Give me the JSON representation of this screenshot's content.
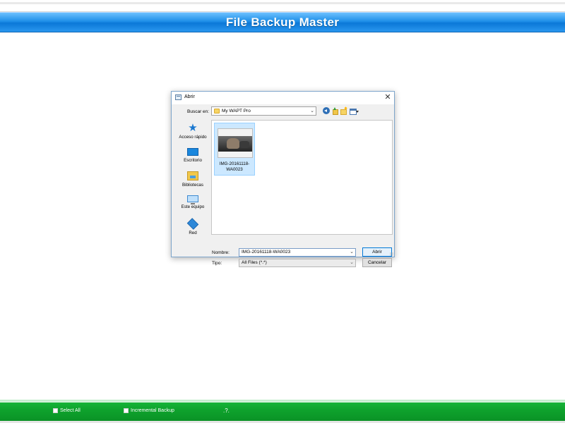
{
  "app": {
    "title": "File Backup Master"
  },
  "bottom_bar": {
    "select_all_label": "Select All",
    "incremental_label": "Incremental Backup",
    "help_label": ".?."
  },
  "dialog": {
    "title": "Abrir",
    "close_label": "✕",
    "look_in_label": "Buscar en:",
    "look_in_value": "My WAPT Pro",
    "places": [
      {
        "label": "Acceso rápido",
        "icon": "quick-access-icon"
      },
      {
        "label": "Escritorio",
        "icon": "desktop-icon"
      },
      {
        "label": "Bibliotecas",
        "icon": "libraries-icon"
      },
      {
        "label": "Este equipo",
        "icon": "this-pc-icon"
      },
      {
        "label": "Red",
        "icon": "network-icon"
      }
    ],
    "files": [
      {
        "name": "IMG-20161118-WA0023"
      }
    ],
    "file_name_label": "Nombre:",
    "file_name_value": "IMG-20161118-WA0023",
    "file_type_label": "Tipo:",
    "file_type_value": "All Files (*.*)",
    "open_label": "Abrir",
    "cancel_label": "Cancelar"
  },
  "colors": {
    "title_bar": "#1f8fe8",
    "bottom_bar": "#0ea12c",
    "selection": "#cce8ff",
    "accent": "#0078d7"
  }
}
